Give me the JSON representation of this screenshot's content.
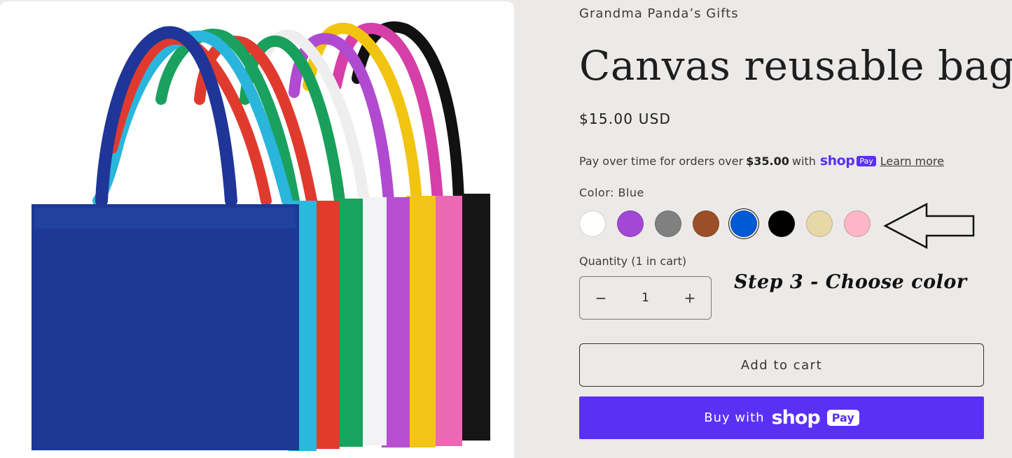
{
  "product": {
    "vendor": "Grandma Panda’s Gifts",
    "title": "Canvas reusable bag",
    "price": "$15.00 USD",
    "installments": {
      "prefix": "Pay over time for orders over",
      "threshold": "$35.00",
      "suffix": "with",
      "shop_word": "shop",
      "pay_word": "Pay",
      "learn_more": "Learn more"
    },
    "color_label": "Color: Blue",
    "swatches": [
      {
        "name": "White",
        "hex": "#ffffff",
        "selected": false
      },
      {
        "name": "Purple",
        "hex": "#a347d6",
        "selected": false
      },
      {
        "name": "Gray",
        "hex": "#808080",
        "selected": false
      },
      {
        "name": "Brown",
        "hex": "#9b4f26",
        "selected": false
      },
      {
        "name": "Blue",
        "hex": "#005ad6",
        "selected": true
      },
      {
        "name": "Black",
        "hex": "#000000",
        "selected": false
      },
      {
        "name": "Natural",
        "hex": "#e8d7a7",
        "selected": false
      },
      {
        "name": "Pink",
        "hex": "#ffb6c6",
        "selected": false
      }
    ],
    "quantity_label": "Quantity (1 in cart)",
    "quantity_value": "1",
    "minus_symbol": "−",
    "plus_symbol": "+",
    "add_to_cart": "Add to cart",
    "buy_with": "Buy with",
    "buy_shop_word": "shop",
    "buy_pay_word": "Pay"
  },
  "annotation": {
    "step_text": "Step 3 - Choose color",
    "arrow_icon": "left-arrow-outline-icon"
  },
  "colors": {
    "background": "#eceae8",
    "shop_purple": "#5a31f4",
    "text_dark": "#1e1e1e"
  }
}
